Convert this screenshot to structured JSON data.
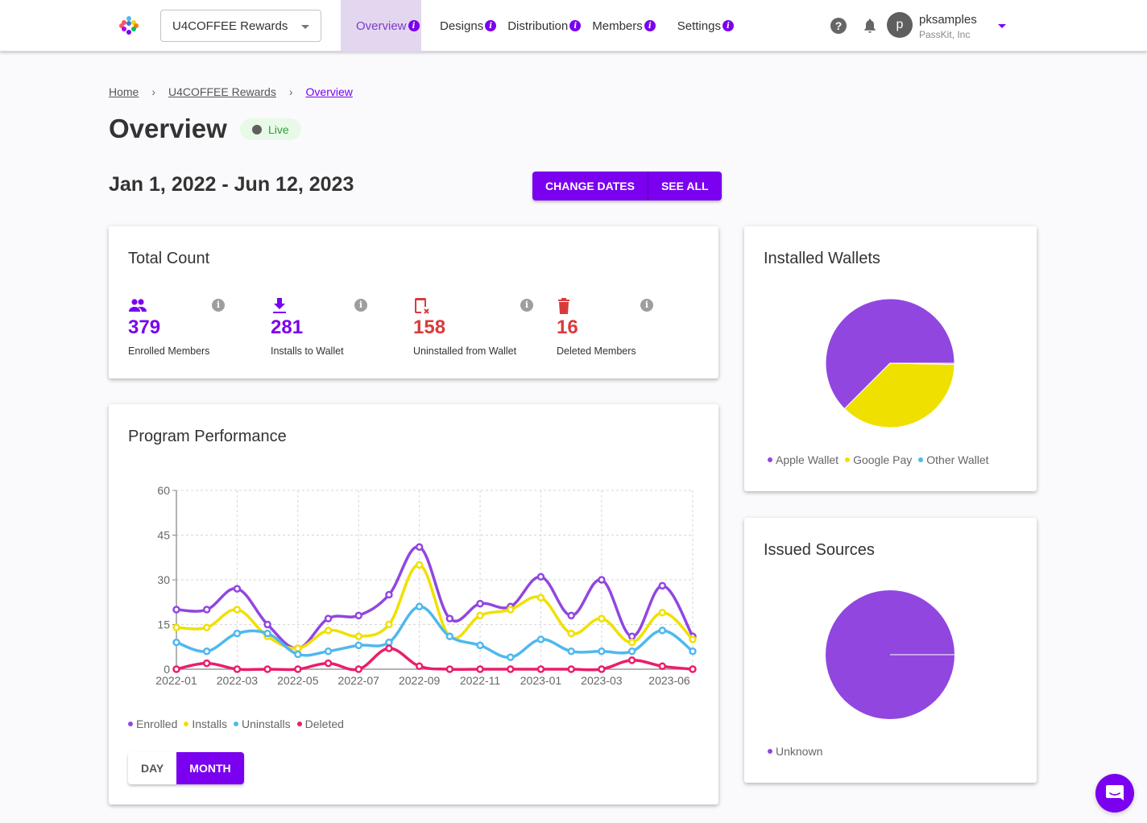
{
  "topbar": {
    "program_selector": "U4COFFEE Rewards",
    "nav": [
      {
        "label": "Overview",
        "active": true
      },
      {
        "label": "Designs",
        "active": false
      },
      {
        "label": "Distribution",
        "active": false
      },
      {
        "label": "Members",
        "active": false
      },
      {
        "label": "Settings",
        "active": false
      }
    ],
    "help_icon": "?",
    "user": {
      "initial": "p",
      "name": "pksamples",
      "org": "PassKit, Inc"
    }
  },
  "breadcrumb": [
    "Home",
    "U4COFFEE Rewards",
    "Overview"
  ],
  "page": {
    "title": "Overview",
    "status": "Live",
    "date_range": "Jan 1, 2022 - Jun 12, 2023",
    "buttons": {
      "change_dates": "CHANGE DATES",
      "see_all": "SEE ALL"
    }
  },
  "total_count": {
    "title": "Total Count",
    "stats": [
      {
        "icon": "people-icon",
        "value": "379",
        "label": "Enrolled Members",
        "color": "#7a00ef"
      },
      {
        "icon": "download-icon",
        "value": "281",
        "label": "Installs to Wallet",
        "color": "#7a00ef"
      },
      {
        "icon": "phone-remove-icon",
        "value": "158",
        "label": "Uninstalled from Wallet",
        "color": "#d93b3b"
      },
      {
        "icon": "trash-icon",
        "value": "16",
        "label": "Deleted Members",
        "color": "#d93b3b"
      }
    ],
    "info_glyph": "i"
  },
  "performance": {
    "title": "Program Performance",
    "toggle": {
      "day": "DAY",
      "month": "MONTH",
      "selected": "MONTH"
    }
  },
  "installed_wallets": {
    "title": "Installed Wallets"
  },
  "issued_sources": {
    "title": "Issued Sources"
  },
  "chart_data": [
    {
      "type": "line",
      "title": "Program Performance",
      "xlabel": "",
      "ylabel": "",
      "ylim": [
        0,
        60
      ],
      "yticks": [
        0,
        15,
        30,
        45,
        60
      ],
      "x": [
        "2022-01",
        "2022-02",
        "2022-03",
        "2022-04",
        "2022-05",
        "2022-06",
        "2022-07",
        "2022-08",
        "2022-09",
        "2022-10",
        "2022-11",
        "2022-12",
        "2023-01",
        "2023-02",
        "2023-03",
        "2023-04",
        "2023-05",
        "2023-06"
      ],
      "xtick_labels": [
        "2022-01",
        "2022-03",
        "2022-05",
        "2022-07",
        "2022-09",
        "2022-11",
        "2023-01",
        "2023-03",
        "2023-06"
      ],
      "grid": true,
      "legend": "bottom-left",
      "series": [
        {
          "name": "Enrolled",
          "color": "#9146e0",
          "values": [
            20,
            20,
            27,
            15,
            7,
            17,
            18,
            25,
            41,
            17,
            22,
            21,
            31,
            18,
            30,
            11,
            28,
            11
          ]
        },
        {
          "name": "Installs",
          "color": "#f0e000",
          "values": [
            14,
            14,
            20,
            11,
            7,
            13,
            11,
            15,
            35,
            11,
            18,
            20,
            24,
            12,
            17,
            9,
            19,
            10
          ]
        },
        {
          "name": "Uninstalls",
          "color": "#4fb8ee",
          "values": [
            9,
            6,
            12,
            12,
            5,
            6,
            8,
            9,
            21,
            11,
            8,
            4,
            10,
            6,
            6,
            6,
            13,
            6
          ]
        },
        {
          "name": "Deleted",
          "color": "#ea1e6a",
          "values": [
            0,
            2,
            0,
            0,
            0,
            2,
            0,
            7,
            1,
            0,
            0,
            0,
            0,
            0,
            0,
            3,
            1,
            0
          ]
        }
      ]
    },
    {
      "type": "pie",
      "title": "Installed Wallets",
      "legend": "bottom",
      "slices": [
        {
          "label": "Apple Wallet",
          "value": 62.5,
          "color": "#9146e0"
        },
        {
          "label": "Google Pay",
          "value": 37.2,
          "color": "#f0e000"
        },
        {
          "label": "Other Wallet",
          "value": 0.3,
          "color": "#4fb8ee"
        }
      ]
    },
    {
      "type": "pie",
      "title": "Issued Sources",
      "legend": "bottom",
      "slices": [
        {
          "label": "Unknown",
          "value": 100,
          "color": "#9146e0"
        }
      ]
    }
  ]
}
